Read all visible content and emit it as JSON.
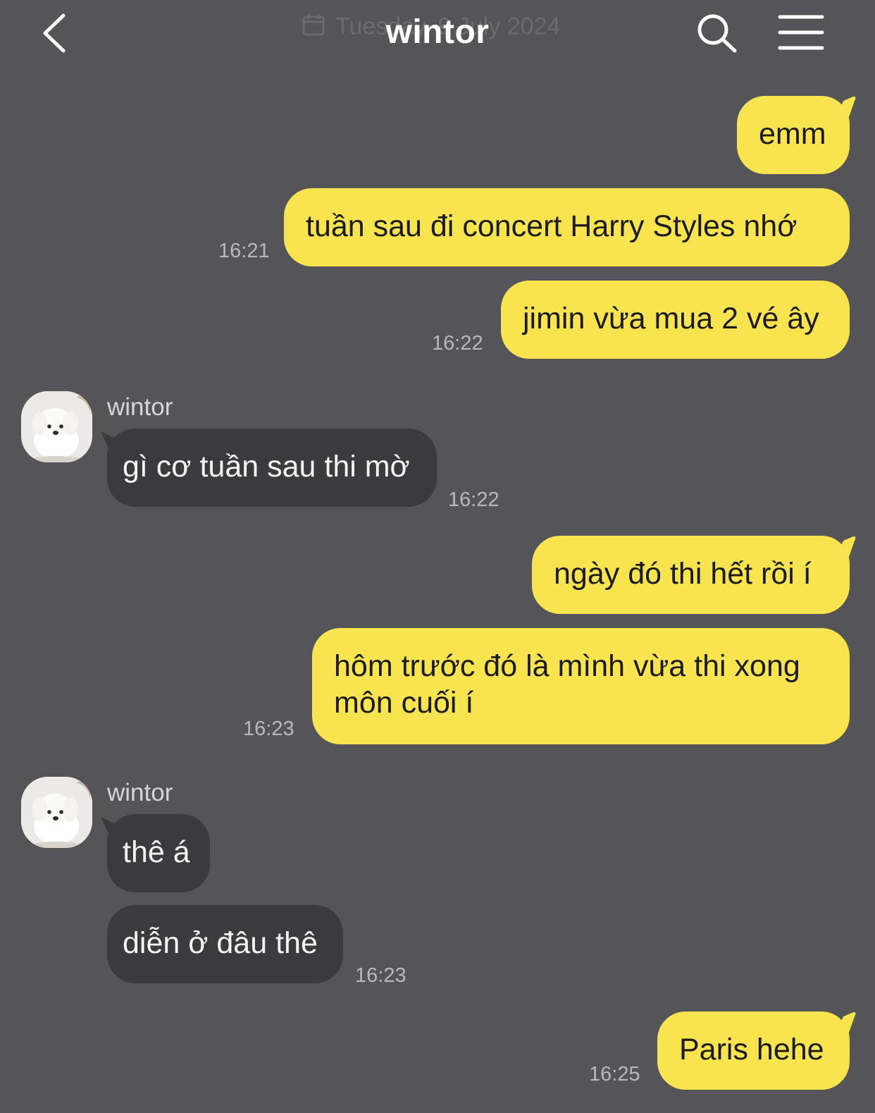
{
  "header": {
    "title": "wintor",
    "date_ghost": "Tuesday, 9 July 2024"
  },
  "icons": {
    "back": "chevron-left-icon",
    "search": "search-icon",
    "menu": "hamburger-menu-icon",
    "calendar": "calendar-icon"
  },
  "colors": {
    "background": "#555457",
    "my_bubble": "#f7e44e",
    "their_bubble": "#3b3a3d"
  },
  "messages": [
    {
      "from": "me",
      "text": "emm",
      "time": ""
    },
    {
      "from": "me",
      "text": "tuần sau đi concert Harry Styles nhớ",
      "time": "16:21"
    },
    {
      "from": "me",
      "text": "jimin vừa mua 2 vé ây",
      "time": "16:22"
    },
    {
      "from": "wintor",
      "sender": "wintor",
      "text": "gì cơ tuần sau thi mờ",
      "time": "16:22"
    },
    {
      "from": "me",
      "text": "ngày đó thi hết rồi í",
      "time": ""
    },
    {
      "from": "me",
      "text_line1": "hôm trước đó là mình vừa thi xong",
      "text_line2": "môn cuối í",
      "time": "16:23"
    },
    {
      "from": "wintor",
      "sender": "wintor",
      "text": "thê á",
      "time": ""
    },
    {
      "from": "wintor",
      "text": "diễn ở đâu thê",
      "time": "16:23"
    },
    {
      "from": "me",
      "text": "Paris hehe",
      "time": "16:25"
    }
  ]
}
